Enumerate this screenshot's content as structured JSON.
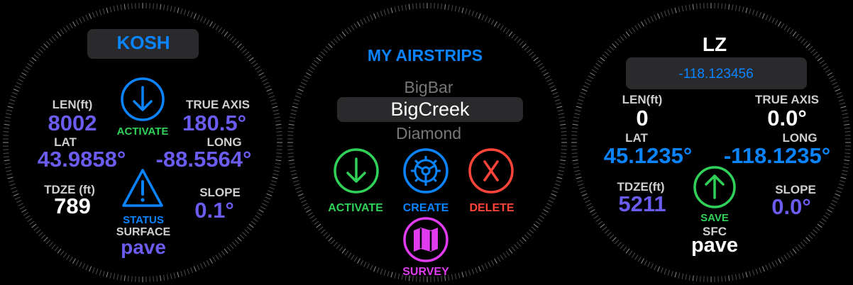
{
  "screens": [
    {
      "title": "KOSH",
      "len_label": "LEN(ft)",
      "len_value": "8002",
      "axis_label": "TRUE AXIS",
      "axis_value": "180.5°",
      "activate_label": "ACTIVATE",
      "lat_label": "LAT",
      "lat_value": "43.9858°",
      "long_label": "LONG",
      "long_value": "-88.5564°",
      "tdze_label": "TDZE (ft)",
      "tdze_value": "789",
      "status_label": "STATUS",
      "slope_label": "SLOPE",
      "slope_value": "0.1°",
      "surface_label": "SURFACE",
      "surface_value": "pave",
      "icons": [
        "arrow-down-circle-icon",
        "warning-triangle-icon"
      ]
    },
    {
      "title": "MY AIRSTRIPS",
      "picker": {
        "above": "BigBar",
        "selected": "BigCreek",
        "below": "Diamond"
      },
      "activate_label": "ACTIVATE",
      "create_label": "CREATE",
      "delete_label": "DELETE",
      "survey_label": "SURVEY",
      "icons": [
        "arrow-down-circle-icon",
        "gear-icon",
        "x-circle-icon",
        "map-icon"
      ]
    },
    {
      "title": "LZ",
      "field_value": "-118.123456",
      "len_label": "LEN(ft)",
      "len_value": "0",
      "axis_label": "TRUE AXIS",
      "axis_value": "0.0°",
      "lat_label": "LAT",
      "lat_value": "45.1235°",
      "long_label": "LONG",
      "long_value": "-118.1235°",
      "tdze_label": "TDZE(ft)",
      "tdze_value": "5211",
      "save_label": "SAVE",
      "slope_label": "SLOPE",
      "slope_value": "0.0°",
      "sfc_label": "SFC",
      "sfc_value": "pave",
      "icons": [
        "arrow-up-circle-icon"
      ]
    }
  ],
  "colors": {
    "purple": "#6b5cf0",
    "blue": "#0a84ff",
    "green": "#30d158",
    "red": "#ff453a",
    "magenta": "#e13bf0",
    "bezel_tick": "#ffffff"
  }
}
